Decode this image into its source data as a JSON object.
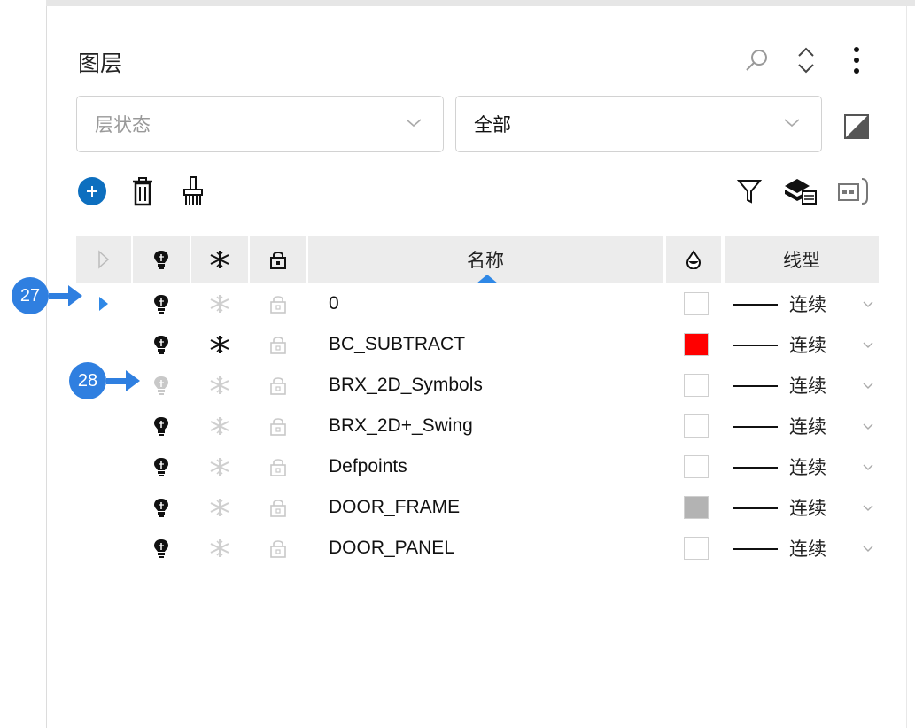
{
  "panel": {
    "title": "图层",
    "header_icons": [
      "search-icon",
      "expand-collapse-icon",
      "more-vertical-icon"
    ]
  },
  "filters": {
    "layer_state": {
      "placeholder": "层状态",
      "value": ""
    },
    "layer_filter": {
      "value": "全部"
    },
    "toggle_icon": "half-square-icon"
  },
  "toolbar": {
    "left_icons": [
      "add-layer-icon",
      "delete-layer-icon",
      "purge-brush-icon"
    ],
    "right_icons": [
      "filter-icon",
      "layer-states-icon",
      "layer-settings-icon"
    ]
  },
  "table": {
    "columns": {
      "current": "",
      "on": "",
      "freeze": "",
      "lock": "",
      "name": "名称",
      "color": "",
      "linetype": "线型"
    },
    "sort_column": "名称",
    "rows": [
      {
        "name": "0",
        "current": true,
        "on": true,
        "frozen": false,
        "locked": false,
        "color": "#ffffff",
        "linetype": "连续"
      },
      {
        "name": "BC_SUBTRACT",
        "current": false,
        "on": true,
        "frozen": true,
        "locked": false,
        "color": "#ff0000",
        "linetype": "连续"
      },
      {
        "name": "BRX_2D_Symbols",
        "current": false,
        "on": false,
        "frozen": false,
        "locked": false,
        "color": "#ffffff",
        "linetype": "连续"
      },
      {
        "name": "BRX_2D+_Swing",
        "current": false,
        "on": true,
        "frozen": false,
        "locked": false,
        "color": "#ffffff",
        "linetype": "连续"
      },
      {
        "name": "Defpoints",
        "current": false,
        "on": true,
        "frozen": false,
        "locked": false,
        "color": "#ffffff",
        "linetype": "连续"
      },
      {
        "name": "DOOR_FRAME",
        "current": false,
        "on": true,
        "frozen": false,
        "locked": false,
        "color": "#b3b3b3",
        "linetype": "连续"
      },
      {
        "name": "DOOR_PANEL",
        "current": false,
        "on": true,
        "frozen": false,
        "locked": false,
        "color": "#ffffff",
        "linetype": "连续"
      }
    ]
  },
  "callouts": [
    {
      "label": "27",
      "target": "current-layer-indicator"
    },
    {
      "label": "28",
      "target": "layer-on-off-toggle"
    }
  ],
  "colors": {
    "accent": "#1a73c8",
    "callout": "#2f7fe0",
    "header_bg": "#ececec"
  }
}
